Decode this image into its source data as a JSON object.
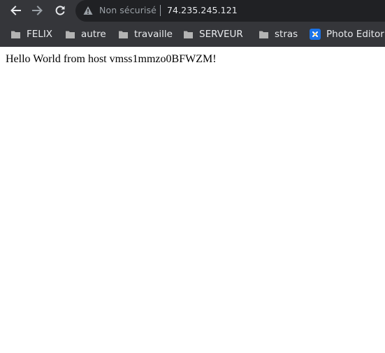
{
  "browser": {
    "security_label": "Non sécurisé",
    "url": "74.235.245.121",
    "icons": {
      "back": "back-arrow-icon",
      "forward": "forward-arrow-icon",
      "reload": "reload-icon",
      "security": "warning-triangle-icon",
      "bookmark_folder": "folder-icon",
      "photo_editor": "photo-editor-icon"
    },
    "colors": {
      "chrome_bg": "#35363a",
      "omnibox_bg": "#202124",
      "text_light": "#e8eaed",
      "text_dim": "#9aa0a6",
      "photo_accent": "#1a73e8"
    }
  },
  "bookmarks": [
    {
      "label": "FELIX",
      "type": "folder"
    },
    {
      "label": "autre",
      "type": "folder"
    },
    {
      "label": "travaille",
      "type": "folder"
    },
    {
      "label": "SERVEUR",
      "type": "folder"
    },
    {
      "label": "stras",
      "type": "folder"
    },
    {
      "label": "Photo Editor",
      "type": "link"
    }
  ],
  "page": {
    "body_text": "Hello World from host vmss1mmzo0BFWZM!"
  }
}
